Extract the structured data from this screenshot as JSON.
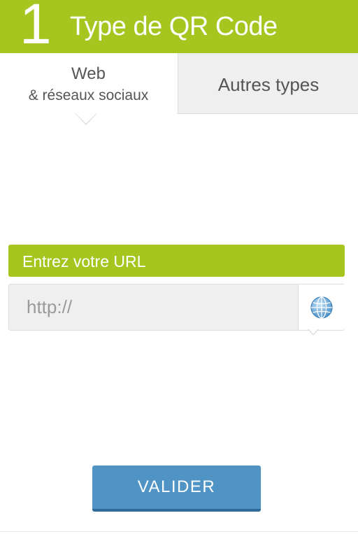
{
  "header": {
    "step_number": "1",
    "title": "Type de QR Code"
  },
  "tabs": [
    {
      "label_line1": "Web",
      "label_line2": "& réseaux sociaux",
      "active": true
    },
    {
      "label": "Autres types",
      "active": false
    }
  ],
  "url_section": {
    "label": "Entrez votre URL",
    "input_value": "",
    "placeholder": "http://",
    "type_icon": "globe-icon"
  },
  "actions": {
    "validate_label": "VALIDER"
  },
  "colors": {
    "brand_green": "#a6c51f",
    "button_blue": "#4f94c4",
    "tab_inactive_bg": "#efefef"
  }
}
